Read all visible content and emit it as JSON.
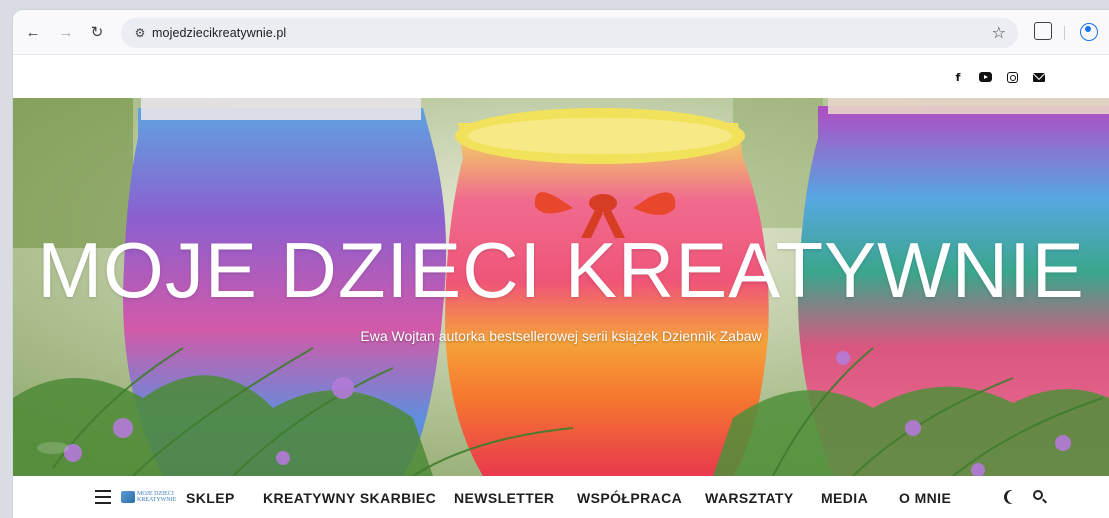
{
  "browser": {
    "url": "mojedziecikreatywnie.pl",
    "icons": [
      "back-icon",
      "forward-icon",
      "reload-icon",
      "site-info-icon",
      "bookmark-star-icon",
      "extensions-icon",
      "profile-icon"
    ]
  },
  "social": {
    "icons": [
      "facebook-icon",
      "youtube-icon",
      "instagram-icon",
      "email-icon"
    ]
  },
  "hero": {
    "title": "MOJE DZIECI KREATYWNIE",
    "subtitle": "Ewa Wojtan autorka bestsellerowej serii książek Dziennik Zabaw"
  },
  "nav": {
    "logo_text_line1": "MOJE DZIECI",
    "logo_text_line2": "KREATYWNIE",
    "items": [
      {
        "label": "SKLEP"
      },
      {
        "label": "KREATYWNY SKARBIEC"
      },
      {
        "label": "NEWSLETTER"
      },
      {
        "label": "WSPÓŁPRACA"
      },
      {
        "label": "WARSZTATY"
      },
      {
        "label": "MEDIA"
      },
      {
        "label": "O MNIE"
      }
    ]
  },
  "colors": {
    "page_bg": "#ffffff",
    "text_dark": "#1f1f1f",
    "omnibox": "#eaedf2",
    "accent_blue": "#1a73e8"
  }
}
